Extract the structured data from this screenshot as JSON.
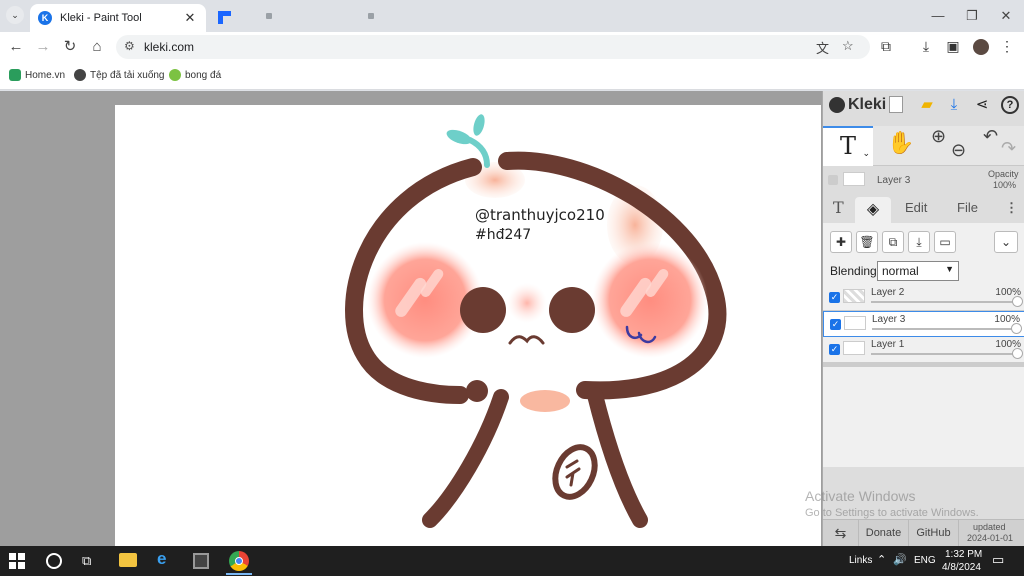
{
  "browser": {
    "tab_title": "Kleki - Paint Tool",
    "tab_favicon_letter": "K",
    "url": "kleki.com",
    "bookmarks": [
      "Home.vn",
      "Tệp đã tải xuống",
      "bong đá"
    ]
  },
  "app": {
    "logo_text": "Kleki",
    "active_layer_label": "Layer 3",
    "opacity_label": "Opacity",
    "opacity_value": "100%",
    "tabs": [
      "Edit",
      "File"
    ],
    "blending_label": "Blending",
    "blending_value": "normal",
    "layers": [
      {
        "name": "Layer 2",
        "opacity": "100%"
      },
      {
        "name": "Layer 3",
        "opacity": "100%"
      },
      {
        "name": "Layer 1",
        "opacity": "100%"
      }
    ],
    "bottom": {
      "donate": "Donate",
      "github": "GitHub",
      "updated_label": "updated",
      "updated_date": "2024-01-01"
    },
    "watermark_title": "Activate Windows",
    "watermark_sub": "Go to Settings to activate Windows.",
    "drawing_text_line1": "@tranthuyjco210",
    "drawing_text_line2": "#hđ247"
  },
  "taskbar": {
    "links_label": "Links",
    "lang": "ENG",
    "time": "1:32 PM",
    "date": "4/8/2024"
  }
}
